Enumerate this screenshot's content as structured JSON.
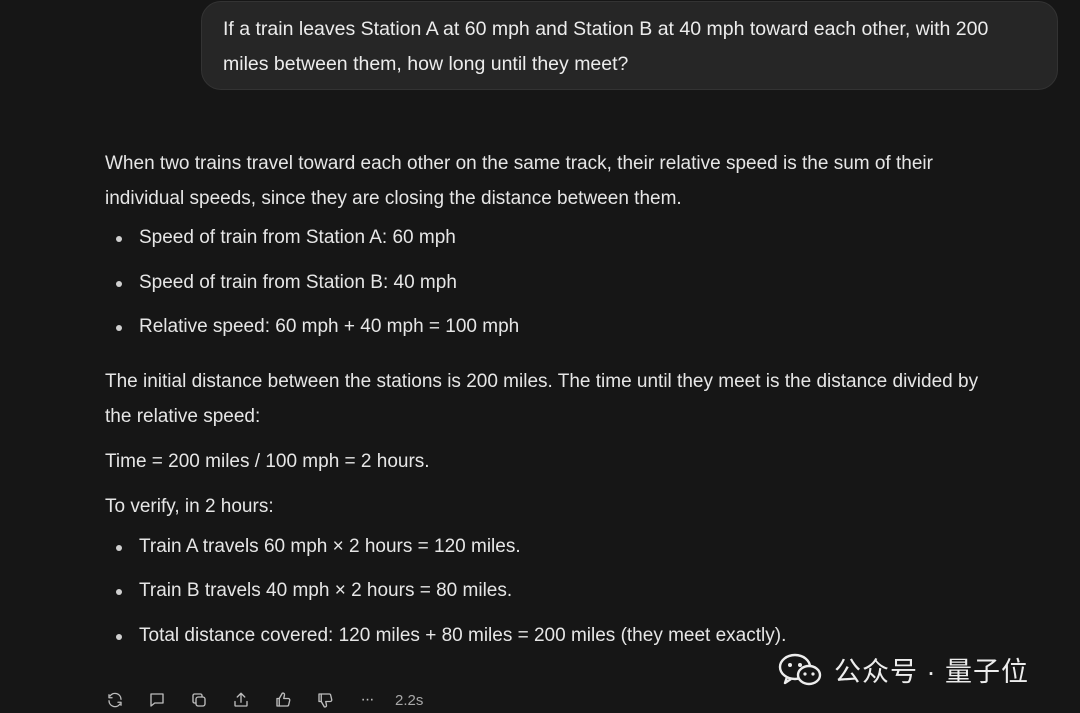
{
  "user_message": {
    "line1": "If a train leaves Station A at 60 mph and Station B at 40 mph toward each other, with 200",
    "line2": "miles between them, how long until they meet?"
  },
  "answer": {
    "intro_line1": "When two trains travel toward each other on the same track, their relative speed is the sum of their",
    "intro_line2": "individual speeds, since they are closing the distance between them.",
    "speeds": [
      "Speed of train from Station A: 60 mph",
      "Speed of train from Station B: 40 mph",
      "Relative speed: 60 mph + 40 mph = 100 mph"
    ],
    "distance_line1": "The initial distance between the stations is 200 miles. The time until they meet is the distance divided by",
    "distance_line2": "the relative speed:",
    "time_formula": "Time = 200 miles / 100 mph = 2 hours.",
    "verify_intro": "To verify, in 2 hours:",
    "verify_items": [
      "Train A travels 60 mph × 2 hours = 120 miles.",
      "Train B travels 40 mph × 2 hours = 80 miles.",
      "Total distance covered: 120 miles + 80 miles = 200 miles (they meet exactly)."
    ]
  },
  "toolbar": {
    "icons": [
      "refresh-icon",
      "comment-icon",
      "copy-icon",
      "share-icon",
      "thumbs-up-icon",
      "thumbs-down-icon",
      "more-icon"
    ],
    "more_label": "···",
    "timing": "2.2s"
  },
  "watermark": {
    "text": "公众号 · 量子位"
  }
}
